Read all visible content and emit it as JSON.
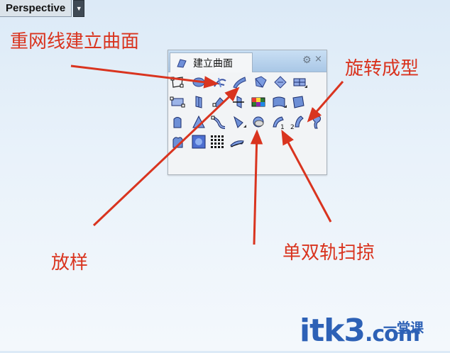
{
  "viewport": {
    "title": "Perspective",
    "dropdown_icon": "triangle-down-icon"
  },
  "panel": {
    "tab_title": "建立曲面",
    "gear_icon": "gear-icon",
    "close_icon": "close-icon",
    "close_glyph": "×",
    "sweep2_label": "2",
    "sweep1_label": "1"
  },
  "annotations": {
    "network": "重网线建立曲面",
    "revolve": "旋转成型",
    "loft": "放样",
    "sweep": "单双轨扫掠"
  },
  "watermark": {
    "main": "itk3",
    "sub": "一堂课",
    "suffix": ".com"
  },
  "colors": {
    "annotation_red": "#d9341f",
    "watermark_blue": "#2d61b6",
    "panel_header": "#b8d3ee"
  }
}
